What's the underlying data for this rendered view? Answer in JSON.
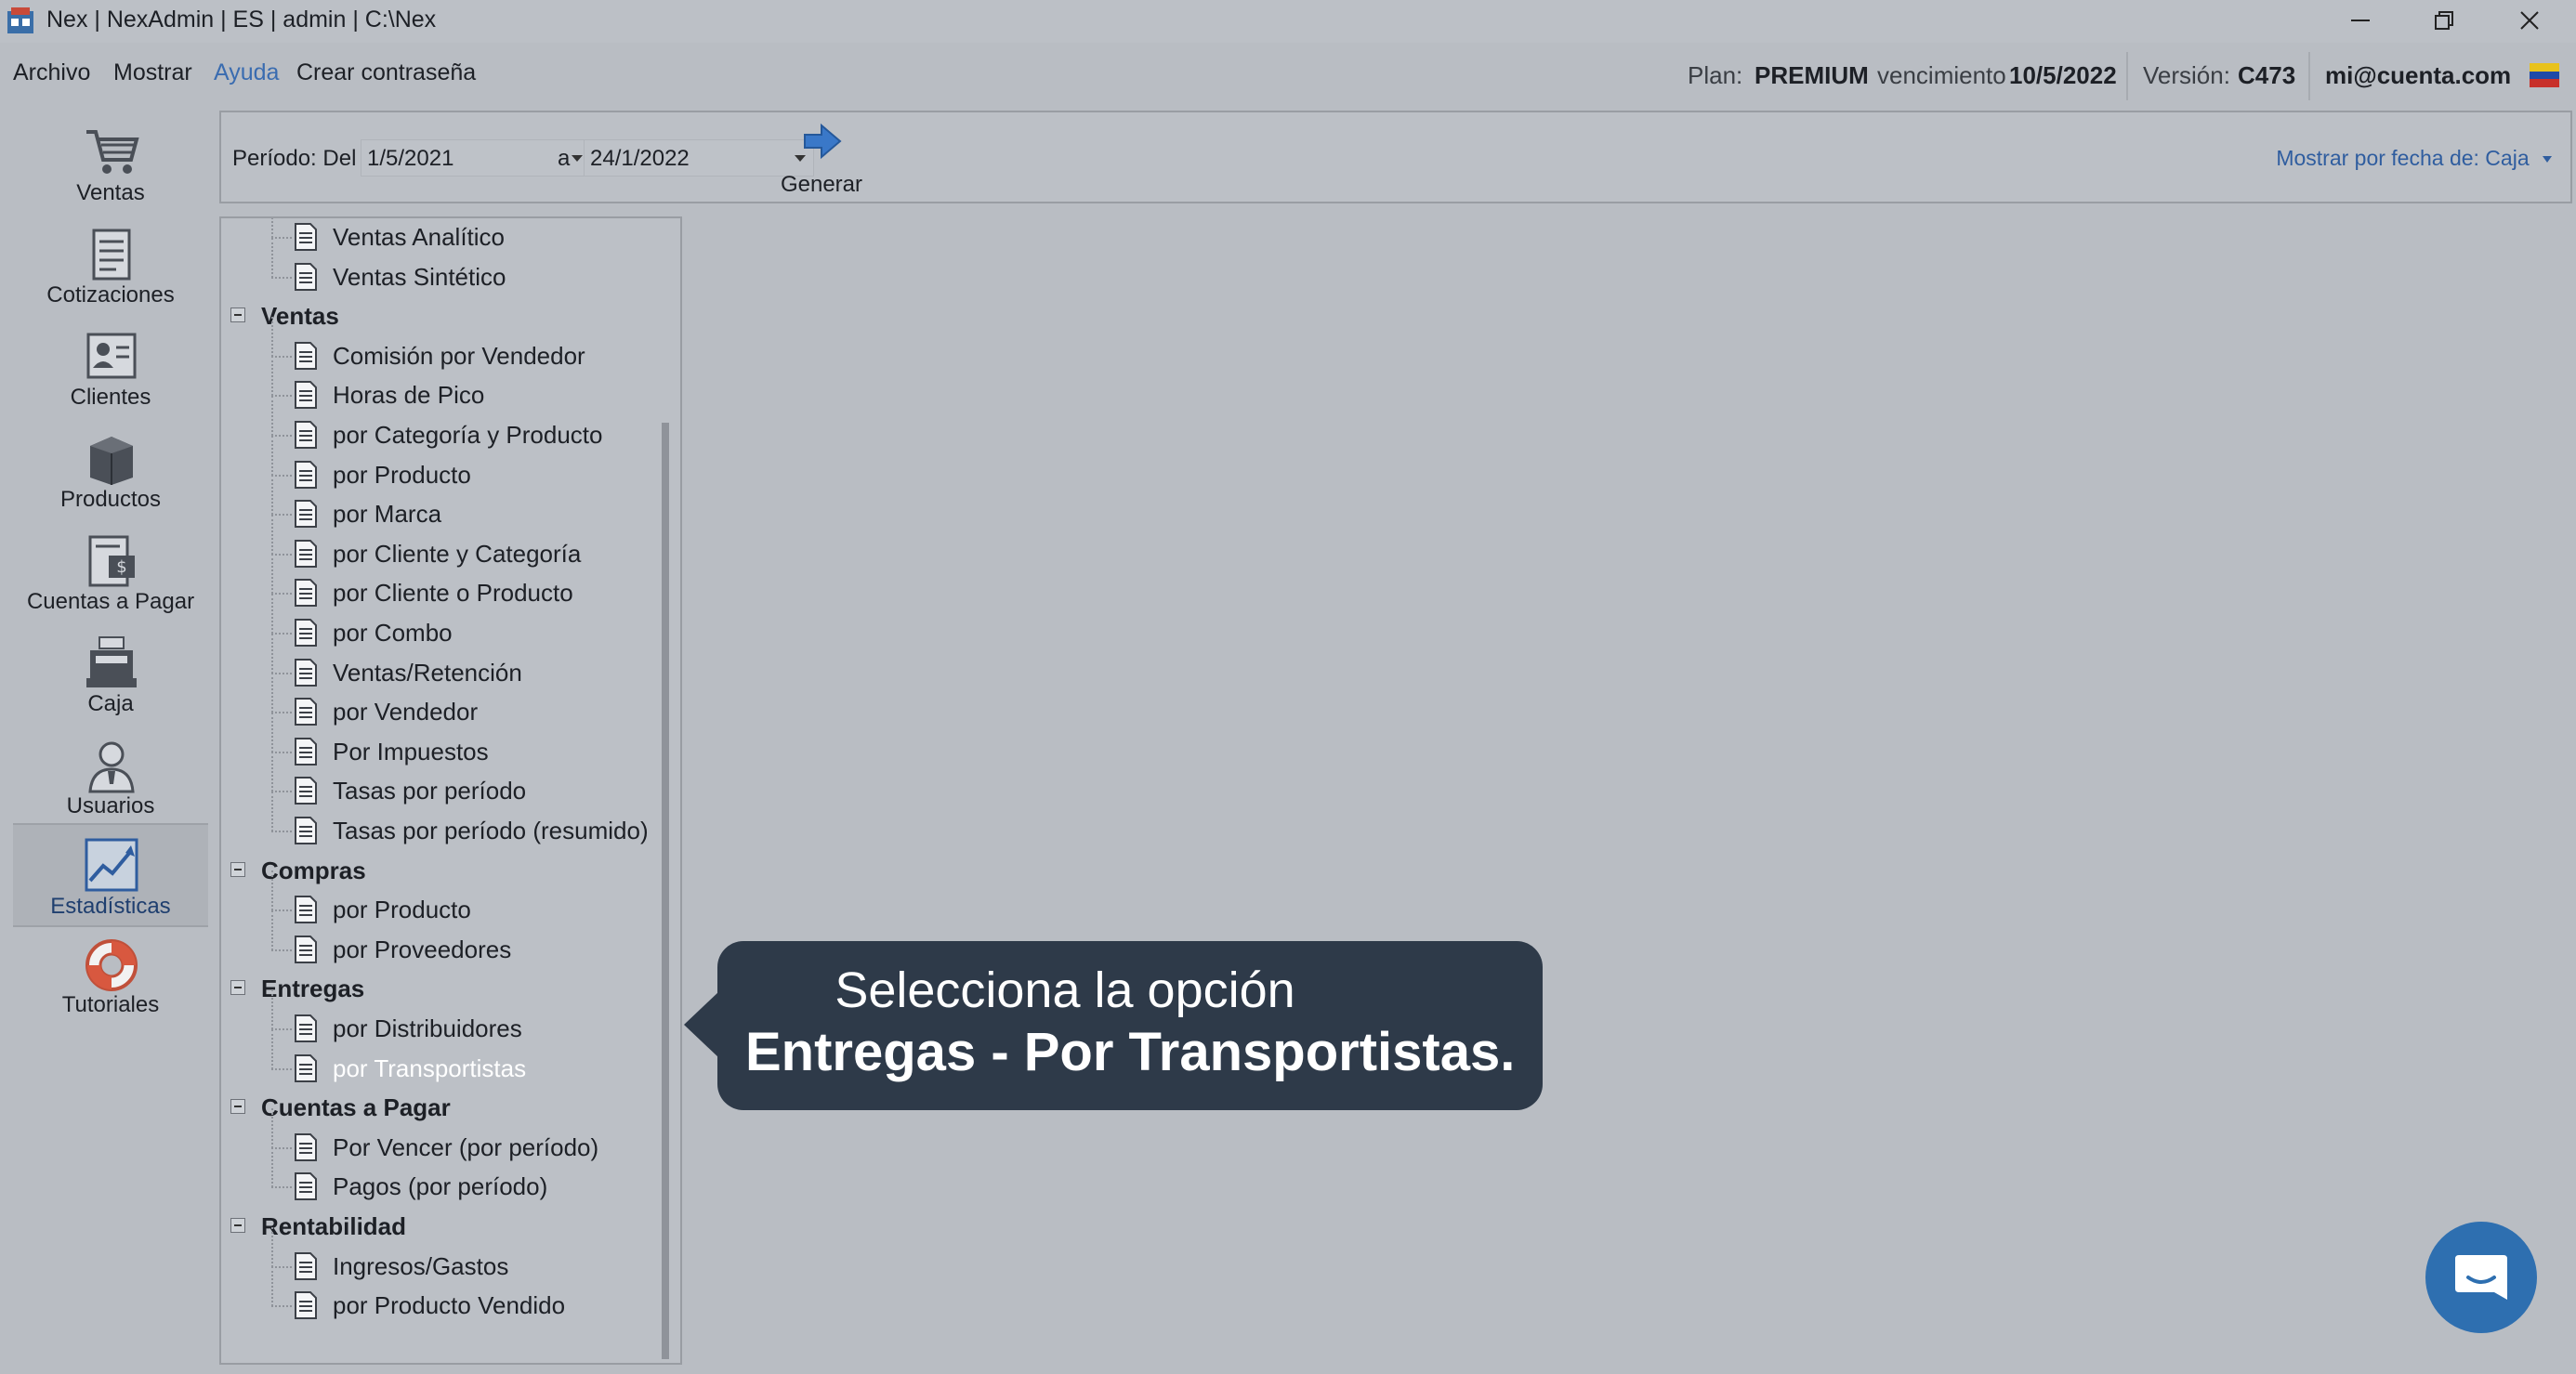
{
  "window": {
    "title": "Nex | NexAdmin | ES | admin | C:\\Nex",
    "controls": [
      "minimize-icon",
      "restore-icon",
      "close-icon"
    ]
  },
  "menu": {
    "items": [
      "Archivo",
      "Mostrar",
      "Ayuda",
      "Crear contraseña"
    ]
  },
  "status": {
    "plan_label": "Plan:",
    "plan_value": "PREMIUM",
    "venc_label": "vencimiento",
    "venc_value": "10/5/2022",
    "version_label": "Versión:",
    "version_value": "C473",
    "account": "mi@cuenta.com"
  },
  "nav": [
    {
      "label": "Ventas",
      "icon": "cart-icon"
    },
    {
      "label": "Cotizaciones",
      "icon": "document-list-icon"
    },
    {
      "label": "Clientes",
      "icon": "client-card-icon"
    },
    {
      "label": "Productos",
      "icon": "box-icon"
    },
    {
      "label": "Cuentas a Pagar",
      "icon": "bill-icon"
    },
    {
      "label": "Caja",
      "icon": "cash-register-icon"
    },
    {
      "label": "Usuarios",
      "icon": "user-icon"
    },
    {
      "label": "Estadísticas",
      "icon": "chart-icon",
      "active": true
    },
    {
      "label": "Tutoriales",
      "icon": "lifebuoy-icon"
    }
  ],
  "toolbar": {
    "periodo_label": "Período: Del",
    "date_from": "1/5/2021",
    "a_label": "a",
    "date_to": "24/1/2022",
    "generar_label": "Generar",
    "mostrar_label": "Mostrar por fecha de: Caja"
  },
  "tree": {
    "rows": [
      {
        "type": "leaf",
        "label": "Ventas Analítico"
      },
      {
        "type": "leaf",
        "label": "Ventas Sintético"
      },
      {
        "type": "cat",
        "label": "Ventas"
      },
      {
        "type": "leaf",
        "label": "Comisión por Vendedor"
      },
      {
        "type": "leaf",
        "label": "Horas de Pico"
      },
      {
        "type": "leaf",
        "label": "por Categoría y Producto"
      },
      {
        "type": "leaf",
        "label": "por Producto"
      },
      {
        "type": "leaf",
        "label": "por Marca"
      },
      {
        "type": "leaf",
        "label": "por Cliente y Categoría"
      },
      {
        "type": "leaf",
        "label": "por Cliente o Producto"
      },
      {
        "type": "leaf",
        "label": "por Combo"
      },
      {
        "type": "leaf",
        "label": "Ventas/Retención"
      },
      {
        "type": "leaf",
        "label": "por Vendedor"
      },
      {
        "type": "leaf",
        "label": "Por Impuestos"
      },
      {
        "type": "leaf",
        "label": "Tasas por período"
      },
      {
        "type": "leaf",
        "label": "Tasas por período (resumido)"
      },
      {
        "type": "cat",
        "label": "Compras"
      },
      {
        "type": "leaf",
        "label": "por Producto"
      },
      {
        "type": "leaf",
        "label": "por Proveedores"
      },
      {
        "type": "cat",
        "label": "Entregas"
      },
      {
        "type": "leaf",
        "label": "por Distribuidores"
      },
      {
        "type": "leaf",
        "label": "por Transportistas",
        "selected": true
      },
      {
        "type": "cat",
        "label": "Cuentas a Pagar"
      },
      {
        "type": "leaf",
        "label": "Por Vencer (por período)"
      },
      {
        "type": "leaf",
        "label": "Pagos (por período)"
      },
      {
        "type": "cat",
        "label": "Rentabilidad"
      },
      {
        "type": "leaf",
        "label": "Ingresos/Gastos"
      },
      {
        "type": "leaf",
        "label": "por Producto Vendido"
      }
    ]
  },
  "callout": {
    "line1": "Selecciona la opción",
    "line2": "Entregas - Por Transportistas."
  },
  "colors": {
    "background": "#b9bdc3",
    "selection": "#0a64d6",
    "callout": "#2e3a49",
    "link": "#2f5d9f",
    "chat": "#2e6fb0"
  }
}
